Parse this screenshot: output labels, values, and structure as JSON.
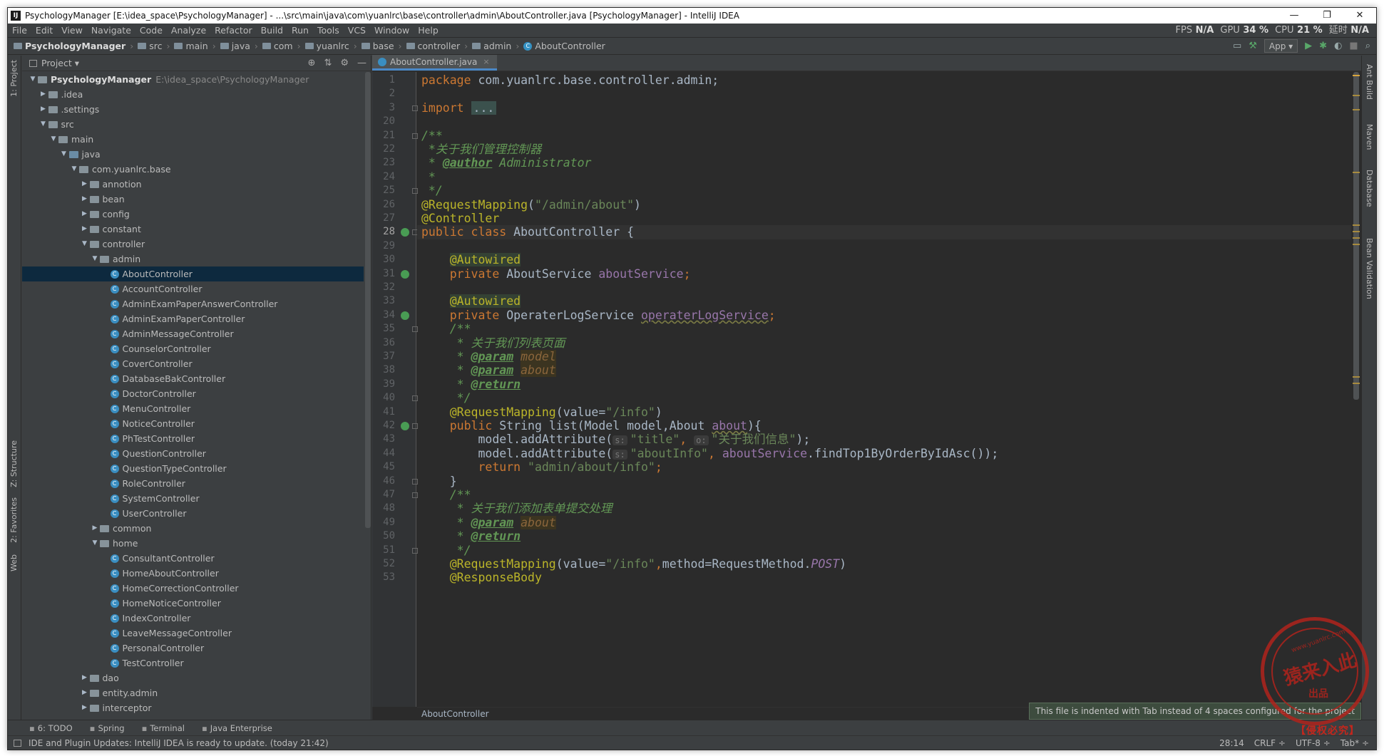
{
  "window": {
    "title": "PsychologyManager [E:\\idea_space\\PsychologyManager] - ...\\src\\main\\java\\com\\yuanlrc\\base\\controller\\admin\\AboutController.java [PsychologyManager] - IntelliJ IDEA",
    "app_icon": "IJ",
    "minimize": "—",
    "restore": "❐",
    "close": "✕"
  },
  "menu": {
    "items": [
      "File",
      "Edit",
      "View",
      "Navigate",
      "Code",
      "Analyze",
      "Refactor",
      "Build",
      "Run",
      "Tools",
      "VCS",
      "Window",
      "Help"
    ],
    "stats": {
      "fps_label": "FPS",
      "fps": "N/A",
      "gpu_label": "GPU",
      "gpu": "34 %",
      "cpu_label": "CPU",
      "cpu": "21 %",
      "lat_label": "延时",
      "lat": "N/A"
    }
  },
  "breadcrumb": [
    "PsychologyManager",
    "src",
    "main",
    "java",
    "com",
    "yuanlrc",
    "base",
    "controller",
    "admin",
    "AboutController"
  ],
  "navtools": {
    "run_config": "App ▾"
  },
  "project": {
    "header": "Project ▾",
    "rows": [
      {
        "indent": 0,
        "arrow": "▼",
        "icon": "folder",
        "label": "PsychologyManager",
        "path": "E:\\idea_space\\PsychologyManager",
        "bold": true
      },
      {
        "indent": 1,
        "arrow": "▶",
        "icon": "folder",
        "label": ".idea"
      },
      {
        "indent": 1,
        "arrow": "▶",
        "icon": "folder",
        "label": ".settings"
      },
      {
        "indent": 1,
        "arrow": "▼",
        "icon": "folder",
        "label": "src"
      },
      {
        "indent": 2,
        "arrow": "▼",
        "icon": "folder",
        "label": "main"
      },
      {
        "indent": 3,
        "arrow": "▼",
        "icon": "src",
        "label": "java"
      },
      {
        "indent": 4,
        "arrow": "▼",
        "icon": "pkg",
        "label": "com.yuanlrc.base"
      },
      {
        "indent": 5,
        "arrow": "▶",
        "icon": "pkg",
        "label": "annotion"
      },
      {
        "indent": 5,
        "arrow": "▶",
        "icon": "pkg",
        "label": "bean"
      },
      {
        "indent": 5,
        "arrow": "▶",
        "icon": "pkg",
        "label": "config"
      },
      {
        "indent": 5,
        "arrow": "▶",
        "icon": "pkg",
        "label": "constant"
      },
      {
        "indent": 5,
        "arrow": "▼",
        "icon": "pkg",
        "label": "controller"
      },
      {
        "indent": 6,
        "arrow": "▼",
        "icon": "pkg",
        "label": "admin"
      },
      {
        "indent": 7,
        "arrow": "",
        "icon": "class",
        "label": "AboutController",
        "selected": true
      },
      {
        "indent": 7,
        "arrow": "",
        "icon": "class",
        "label": "AccountController"
      },
      {
        "indent": 7,
        "arrow": "",
        "icon": "class",
        "label": "AdminExamPaperAnswerController"
      },
      {
        "indent": 7,
        "arrow": "",
        "icon": "class",
        "label": "AdminExamPaperController"
      },
      {
        "indent": 7,
        "arrow": "",
        "icon": "class",
        "label": "AdminMessageController"
      },
      {
        "indent": 7,
        "arrow": "",
        "icon": "class",
        "label": "CounselorController"
      },
      {
        "indent": 7,
        "arrow": "",
        "icon": "class",
        "label": "CoverController"
      },
      {
        "indent": 7,
        "arrow": "",
        "icon": "class",
        "label": "DatabaseBakController"
      },
      {
        "indent": 7,
        "arrow": "",
        "icon": "class",
        "label": "DoctorController"
      },
      {
        "indent": 7,
        "arrow": "",
        "icon": "class",
        "label": "MenuController"
      },
      {
        "indent": 7,
        "arrow": "",
        "icon": "class",
        "label": "NoticeController"
      },
      {
        "indent": 7,
        "arrow": "",
        "icon": "class",
        "label": "PhTestController"
      },
      {
        "indent": 7,
        "arrow": "",
        "icon": "class",
        "label": "QuestionController"
      },
      {
        "indent": 7,
        "arrow": "",
        "icon": "class",
        "label": "QuestionTypeController"
      },
      {
        "indent": 7,
        "arrow": "",
        "icon": "class",
        "label": "RoleController"
      },
      {
        "indent": 7,
        "arrow": "",
        "icon": "class",
        "label": "SystemController"
      },
      {
        "indent": 7,
        "arrow": "",
        "icon": "class",
        "label": "UserController"
      },
      {
        "indent": 6,
        "arrow": "▶",
        "icon": "pkg",
        "label": "common"
      },
      {
        "indent": 6,
        "arrow": "▼",
        "icon": "pkg",
        "label": "home"
      },
      {
        "indent": 7,
        "arrow": "",
        "icon": "class",
        "label": "ConsultantController"
      },
      {
        "indent": 7,
        "arrow": "",
        "icon": "class",
        "label": "HomeAboutController"
      },
      {
        "indent": 7,
        "arrow": "",
        "icon": "class",
        "label": "HomeCorrectionController"
      },
      {
        "indent": 7,
        "arrow": "",
        "icon": "class",
        "label": "HomeNoticeController"
      },
      {
        "indent": 7,
        "arrow": "",
        "icon": "class",
        "label": "IndexController"
      },
      {
        "indent": 7,
        "arrow": "",
        "icon": "class",
        "label": "LeaveMessageController"
      },
      {
        "indent": 7,
        "arrow": "",
        "icon": "class",
        "label": "PersonalController"
      },
      {
        "indent": 7,
        "arrow": "",
        "icon": "class",
        "label": "TestController"
      },
      {
        "indent": 5,
        "arrow": "▶",
        "icon": "pkg",
        "label": "dao"
      },
      {
        "indent": 5,
        "arrow": "▶",
        "icon": "pkg",
        "label": "entity.admin"
      },
      {
        "indent": 5,
        "arrow": "▶",
        "icon": "pkg",
        "label": "interceptor"
      }
    ]
  },
  "left_strip": {
    "project": "1: Project",
    "structure": "Z: Structure",
    "favorites": "2: Favorites",
    "web": "Web"
  },
  "right_strip": {
    "ant": "Ant Build",
    "maven": "Maven",
    "database": "Database",
    "bean": "Bean Validation"
  },
  "editor": {
    "tab": "AboutController.java",
    "tab_close": "×",
    "footer": "AboutController",
    "current_line": "28",
    "lines": [
      {
        "n": "1",
        "tokens": [
          [
            "kw",
            "package "
          ],
          [
            "",
            "com.yuanlrc.base.controller.admin;"
          ]
        ]
      },
      {
        "n": "2",
        "tokens": []
      },
      {
        "n": "3",
        "tokens": [
          [
            "kw",
            "import "
          ],
          [
            "dots",
            "..."
          ]
        ]
      },
      {
        "n": "20",
        "tokens": []
      },
      {
        "n": "21",
        "tokens": [
          [
            "cm",
            "/**"
          ]
        ]
      },
      {
        "n": "22",
        "tokens": [
          [
            "cm",
            " *关于我们管理控制器"
          ]
        ]
      },
      {
        "n": "23",
        "tokens": [
          [
            "cm",
            " * "
          ],
          [
            "doctag",
            "@author"
          ],
          [
            "cm",
            " Administrator"
          ]
        ]
      },
      {
        "n": "24",
        "tokens": [
          [
            "cm",
            " *"
          ]
        ]
      },
      {
        "n": "25",
        "tokens": [
          [
            "cm",
            " */"
          ]
        ]
      },
      {
        "n": "26",
        "tokens": [
          [
            "ann",
            "@RequestMapping"
          ],
          [
            "",
            "("
          ],
          [
            "str",
            "\"/admin/about\""
          ],
          [
            "",
            ")"
          ]
        ]
      },
      {
        "n": "27",
        "tokens": [
          [
            "ann",
            "@Controller"
          ]
        ]
      },
      {
        "n": "28",
        "tokens": [
          [
            "kw",
            "public class "
          ],
          [
            "",
            "AboutController {"
          ]
        ]
      },
      {
        "n": "29",
        "tokens": []
      },
      {
        "n": "30",
        "tokens": [
          [
            "",
            "    "
          ],
          [
            "annbg",
            "@Autowired"
          ]
        ]
      },
      {
        "n": "31",
        "tokens": [
          [
            "kw",
            "    private "
          ],
          [
            "",
            "AboutService "
          ],
          [
            "fld",
            "aboutService"
          ],
          [
            "kw",
            ";"
          ]
        ]
      },
      {
        "n": "32",
        "tokens": []
      },
      {
        "n": "33",
        "tokens": [
          [
            "",
            "    "
          ],
          [
            "annbg",
            "@Autowired"
          ]
        ]
      },
      {
        "n": "34",
        "tokens": [
          [
            "kw",
            "    private "
          ],
          [
            "",
            "OperaterLogService "
          ],
          [
            "grey",
            "operaterLogService"
          ],
          [
            "kw",
            ";"
          ]
        ]
      },
      {
        "n": "35",
        "tokens": [
          [
            "cm",
            "    /**"
          ]
        ]
      },
      {
        "n": "36",
        "tokens": [
          [
            "cm",
            "     * 关于我们列表页面"
          ]
        ]
      },
      {
        "n": "37",
        "tokens": [
          [
            "cm",
            "     * "
          ],
          [
            "doctag",
            "@param"
          ],
          [
            "cm",
            " "
          ],
          [
            "docparam",
            "model"
          ]
        ]
      },
      {
        "n": "38",
        "tokens": [
          [
            "cm",
            "     * "
          ],
          [
            "doctag",
            "@param"
          ],
          [
            "cm",
            " "
          ],
          [
            "docparam",
            "about"
          ]
        ]
      },
      {
        "n": "39",
        "tokens": [
          [
            "cm",
            "     * "
          ],
          [
            "doctag",
            "@return"
          ]
        ]
      },
      {
        "n": "40",
        "tokens": [
          [
            "cm",
            "     */"
          ]
        ]
      },
      {
        "n": "41",
        "tokens": [
          [
            "ann",
            "    @RequestMapping"
          ],
          [
            "",
            "("
          ],
          [
            "",
            "value="
          ],
          [
            "str",
            "\"/info\""
          ],
          [
            "",
            ")"
          ]
        ]
      },
      {
        "n": "42",
        "tokens": [
          [
            "kw",
            "    public "
          ],
          [
            "",
            "String "
          ],
          [
            "",
            "list(Model model,About "
          ],
          [
            "grey",
            "about"
          ],
          [
            "",
            "){"
          ]
        ]
      },
      {
        "n": "43",
        "tokens": [
          [
            "",
            "        model.addAttribute("
          ],
          [
            "hint",
            "s:"
          ],
          [
            "str",
            "\"title\""
          ],
          [
            "kw",
            ", "
          ],
          [
            "hint",
            "o:"
          ],
          [
            "str",
            "\"关于我们信息\""
          ],
          [
            "",
            ");"
          ]
        ]
      },
      {
        "n": "44",
        "tokens": [
          [
            "",
            "        model.addAttribute("
          ],
          [
            "hint",
            "s:"
          ],
          [
            "str",
            "\"aboutInfo\""
          ],
          [
            "kw",
            ", "
          ],
          [
            "fld",
            "aboutService"
          ],
          [
            "",
            ".findTop1ByOrderByIdAsc());"
          ]
        ]
      },
      {
        "n": "45",
        "tokens": [
          [
            "kw",
            "        return "
          ],
          [
            "str",
            "\"admin/about/info\""
          ],
          [
            "kw",
            ";"
          ]
        ]
      },
      {
        "n": "46",
        "tokens": [
          [
            "",
            "    }"
          ]
        ]
      },
      {
        "n": "47",
        "tokens": [
          [
            "cm",
            "    /**"
          ]
        ]
      },
      {
        "n": "48",
        "tokens": [
          [
            "cm",
            "     * 关于我们添加表单提交处理"
          ]
        ]
      },
      {
        "n": "49",
        "tokens": [
          [
            "cm",
            "     * "
          ],
          [
            "doctag",
            "@param"
          ],
          [
            "cm",
            " "
          ],
          [
            "docparam",
            "about"
          ]
        ]
      },
      {
        "n": "50",
        "tokens": [
          [
            "cm",
            "     * "
          ],
          [
            "doctag",
            "@return"
          ]
        ]
      },
      {
        "n": "51",
        "tokens": [
          [
            "cm",
            "     */"
          ]
        ]
      },
      {
        "n": "52",
        "tokens": [
          [
            "ann",
            "    @RequestMapping"
          ],
          [
            "",
            "(value="
          ],
          [
            "str",
            "\"/info\""
          ],
          [
            "kw",
            ","
          ],
          [
            "",
            "method=RequestMethod."
          ],
          [
            "stat",
            "POST"
          ],
          [
            "",
            ")"
          ]
        ]
      },
      {
        "n": "53",
        "tokens": [
          [
            "ann",
            "    @ResponseBody"
          ]
        ]
      }
    ]
  },
  "bottom_tools": [
    "6: TODO",
    "Spring",
    "Terminal",
    "Java Enterprise"
  ],
  "status": {
    "message": "IDE and Plugin Updates: IntelliJ IDEA is ready to update. (today 21:42)",
    "position": "28:14",
    "line_sep": "CRLF ÷",
    "encoding": "UTF-8 ÷",
    "indent": "Tab* ÷"
  },
  "balloon": "This file is indented with Tab instead of 4 spaces configured for the project",
  "stamp": {
    "url": "www.yuanlrc.com",
    "main": "猿来入此",
    "sub": "出品",
    "watermark": "【侵权必究】"
  },
  "colors": {
    "keyword": "#cc7832",
    "string": "#6a8759",
    "annotation": "#bbb529",
    "comment": "#629755",
    "field": "#9876aa",
    "background": "#2b2b2b"
  }
}
